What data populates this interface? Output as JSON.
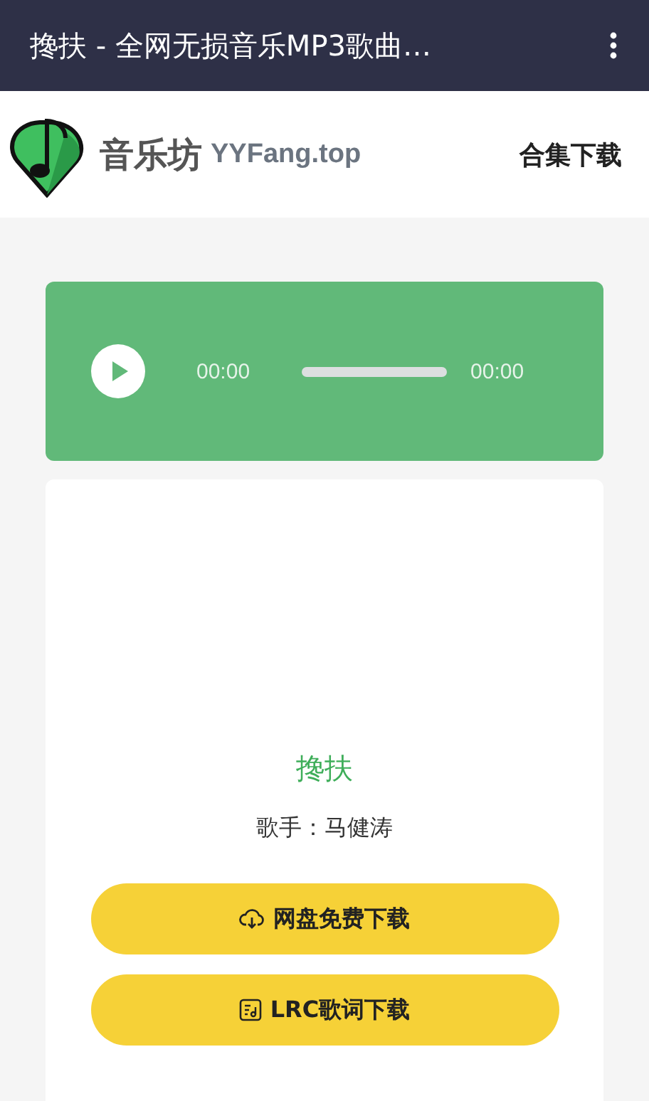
{
  "app_bar": {
    "title": "搀扶 - 全网无损音乐MP3歌曲…"
  },
  "header": {
    "site_name": "音乐坊",
    "domain": "YYFang.top",
    "nav_link": "合集下载"
  },
  "player": {
    "current_time": "00:00",
    "duration": "00:00",
    "progress": {
      "level": 0
    }
  },
  "song": {
    "title": "搀扶",
    "artist": "歌手：马健涛"
  },
  "buttons": [
    {
      "kind": "cloud",
      "label": "网盘免费下载"
    },
    {
      "kind": "lyrics",
      "label": "LRC歌词下载"
    }
  ]
}
